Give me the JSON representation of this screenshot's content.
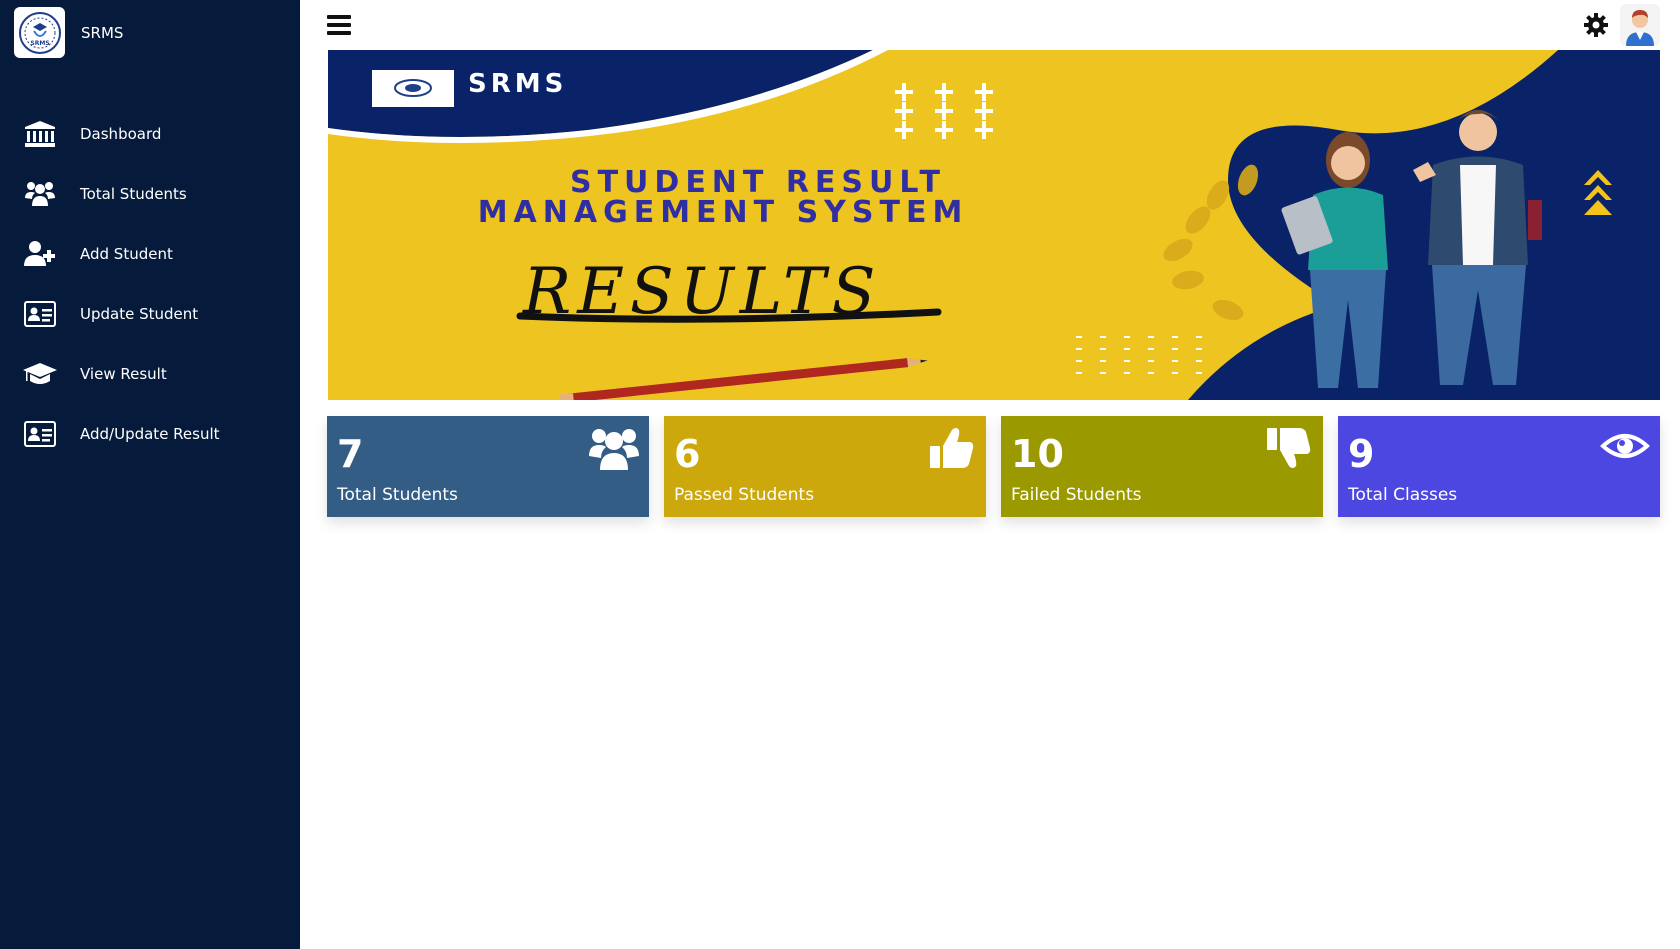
{
  "brand": {
    "name": "SRMS"
  },
  "sidebar": {
    "items": [
      {
        "label": "Dashboard",
        "icon": "bank-icon"
      },
      {
        "label": "Total Students",
        "icon": "users-icon"
      },
      {
        "label": "Add Student",
        "icon": "user-plus-icon"
      },
      {
        "label": "Update Student",
        "icon": "id-card-icon"
      },
      {
        "label": "View Result",
        "icon": "graduation-cap-icon"
      },
      {
        "label": "Add/Update Result",
        "icon": "id-card-icon"
      }
    ]
  },
  "banner": {
    "brand": "SRMS",
    "line1": "STUDENT RESULT",
    "line2": "MANAGEMENT SYSTEM",
    "word": "RESULTS"
  },
  "cards": [
    {
      "value": "7",
      "label": "Total Students",
      "icon": "users-icon",
      "color": "#335d85"
    },
    {
      "value": "6",
      "label": "Passed Students",
      "icon": "thumbs-up-icon",
      "color": "#cca80c"
    },
    {
      "value": "10",
      "label": "Failed Students",
      "icon": "thumbs-down-icon",
      "color": "#9a9a00"
    },
    {
      "value": "9",
      "label": "Total Classes",
      "icon": "eye-icon",
      "color": "#4d47e1"
    }
  ],
  "colors": {
    "sidebar": "#061b3c",
    "banner_yellow": "#eec421",
    "banner_navy": "#0a2368",
    "banner_text": "#2f2fa3"
  }
}
